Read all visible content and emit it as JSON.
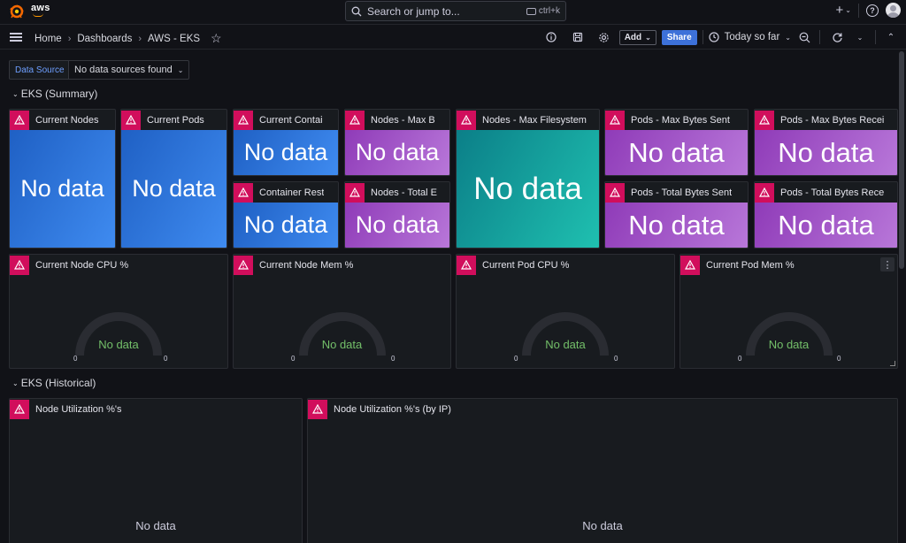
{
  "topbar": {
    "org": "aws",
    "search_placeholder": "Search or jump to...",
    "search_shortcut": "ctrl+k",
    "plus_icon": "plus-icon",
    "help_icon": "help-icon"
  },
  "nav": {
    "breadcrumbs": [
      "Home",
      "Dashboards",
      "AWS - EKS"
    ],
    "add_label": "Add",
    "share_label": "Share",
    "time_range": "Today so far"
  },
  "variables": {
    "label": "Data Source",
    "value": "No data sources found"
  },
  "rows": [
    {
      "title": "EKS (Summary)"
    },
    {
      "title": "EKS (Historical)"
    }
  ],
  "stat_panels": [
    {
      "title": "Current Nodes",
      "value": "No data",
      "color": "blue"
    },
    {
      "title": "Current Pods",
      "value": "No data",
      "color": "blue"
    },
    {
      "title": "Current Contai",
      "value": "No data",
      "color": "blue"
    },
    {
      "title": "Nodes - Max B",
      "value": "No data",
      "color": "purple"
    },
    {
      "title": "Nodes - Max Filesystem",
      "value": "No data",
      "color": "teal"
    },
    {
      "title": "Pods - Max Bytes Sent",
      "value": "No data",
      "color": "purple"
    },
    {
      "title": "Pods - Max Bytes Recei",
      "value": "No data",
      "color": "purple"
    },
    {
      "title": "Container Rest",
      "value": "No data",
      "color": "blue"
    },
    {
      "title": "Nodes - Total E",
      "value": "No data",
      "color": "purple"
    },
    {
      "title": "Pods - Total Bytes Sent",
      "value": "No data",
      "color": "purple"
    },
    {
      "title": "Pods - Total Bytes Rece",
      "value": "No data",
      "color": "purple"
    }
  ],
  "gauge_panels": [
    {
      "title": "Current Node CPU %",
      "value": "No data",
      "min": "0",
      "max": "0"
    },
    {
      "title": "Current Node Mem %",
      "value": "No data",
      "min": "0",
      "max": "0"
    },
    {
      "title": "Current Pod CPU %",
      "value": "No data",
      "min": "0",
      "max": "0"
    },
    {
      "title": "Current Pod Mem %",
      "value": "No data",
      "min": "0",
      "max": "0"
    }
  ],
  "historical_panels": [
    {
      "title": "Node Utilization %'s",
      "value": "No data"
    },
    {
      "title": "Node Utilization %'s (by IP)",
      "value": "No data"
    }
  ],
  "colors": {
    "blue": "#1f60c4",
    "purple": "#8f3bb8",
    "teal": "#0b7f88",
    "warning": "#d10e5c",
    "gauge_text": "#73bf69",
    "share_button": "#3d71d9"
  }
}
